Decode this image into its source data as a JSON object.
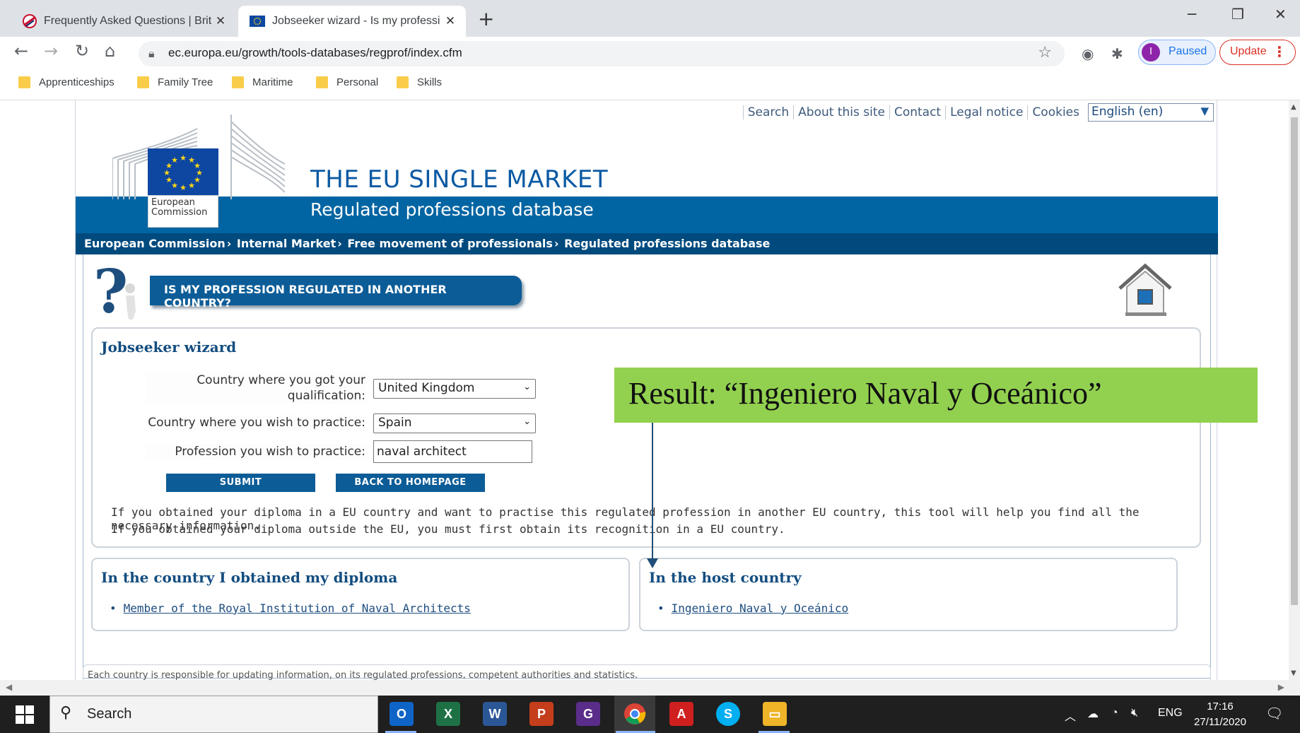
{
  "browser": {
    "tabs": [
      {
        "title": "Frequently Asked Questions | Brit",
        "icon": "brand-logo-icon"
      },
      {
        "title": "Jobseeker wizard - Is my professi",
        "icon": "eu-flag-icon",
        "active": true
      }
    ],
    "url": "ec.europa.eu/growth/tools-databases/regprof/index.cfm",
    "profile_label": "Paused",
    "profile_initial": "I",
    "update_label": "Update",
    "bookmarks": [
      "Apprenticeships",
      "Family Tree",
      "Maritime",
      "Personal",
      "Skills"
    ]
  },
  "site": {
    "top_links": [
      "Search",
      "About this site",
      "Contact",
      "Legal notice",
      "Cookies"
    ],
    "language": "English (en)",
    "ec_logo_text": [
      "European",
      "Commission"
    ],
    "title": "THE EU SINGLE MARKET",
    "subtitle": "Regulated professions database",
    "breadcrumbs": [
      "European Commission",
      "Internal Market",
      "Free movement of professionals",
      "Regulated professions database"
    ],
    "banner": "IS MY PROFESSION REGULATED IN ANOTHER COUNTRY?"
  },
  "wizard": {
    "title": "Jobseeker wizard",
    "qualification_label_1": "Country where you got your",
    "qualification_label_2": "qualification:",
    "qualification_value": "United Kingdom",
    "practice_label": "Country where you wish to practice:",
    "practice_value": "Spain",
    "profession_label": "Profession you wish to practice:",
    "profession_value": "naval architect",
    "submit_label": "SUBMIT",
    "back_label": "BACK TO HOMEPAGE",
    "info_1": "If you obtained your diploma in a EU country and want to practise this regulated profession in another EU country, this tool will help you find all the necessary information.",
    "info_2": "If you obtained your diploma outside the EU, you must first obtain its recognition in a EU country."
  },
  "results": {
    "origin_title": "In the country I obtained my diploma",
    "origin_item": "Member of the Royal Institution of Naval Architects",
    "host_title": "In the host country",
    "host_item": "Ingeniero Naval y Oceánico"
  },
  "footer_note": "Each country is responsible for updating information, on its regulated professions, competent authorities and statistics.",
  "annotation": {
    "text": "Result: “Ingeniero Naval y Oceánico”",
    "color": "#92d050"
  },
  "taskbar": {
    "search_label": "Search",
    "apps": [
      "outlook",
      "excel",
      "word",
      "powerpoint",
      "pdf-tool",
      "chrome",
      "acrobat",
      "skype",
      "file-explorer"
    ],
    "tray_lang": "ENG",
    "time": "17:16",
    "date": "27/11/2020"
  }
}
